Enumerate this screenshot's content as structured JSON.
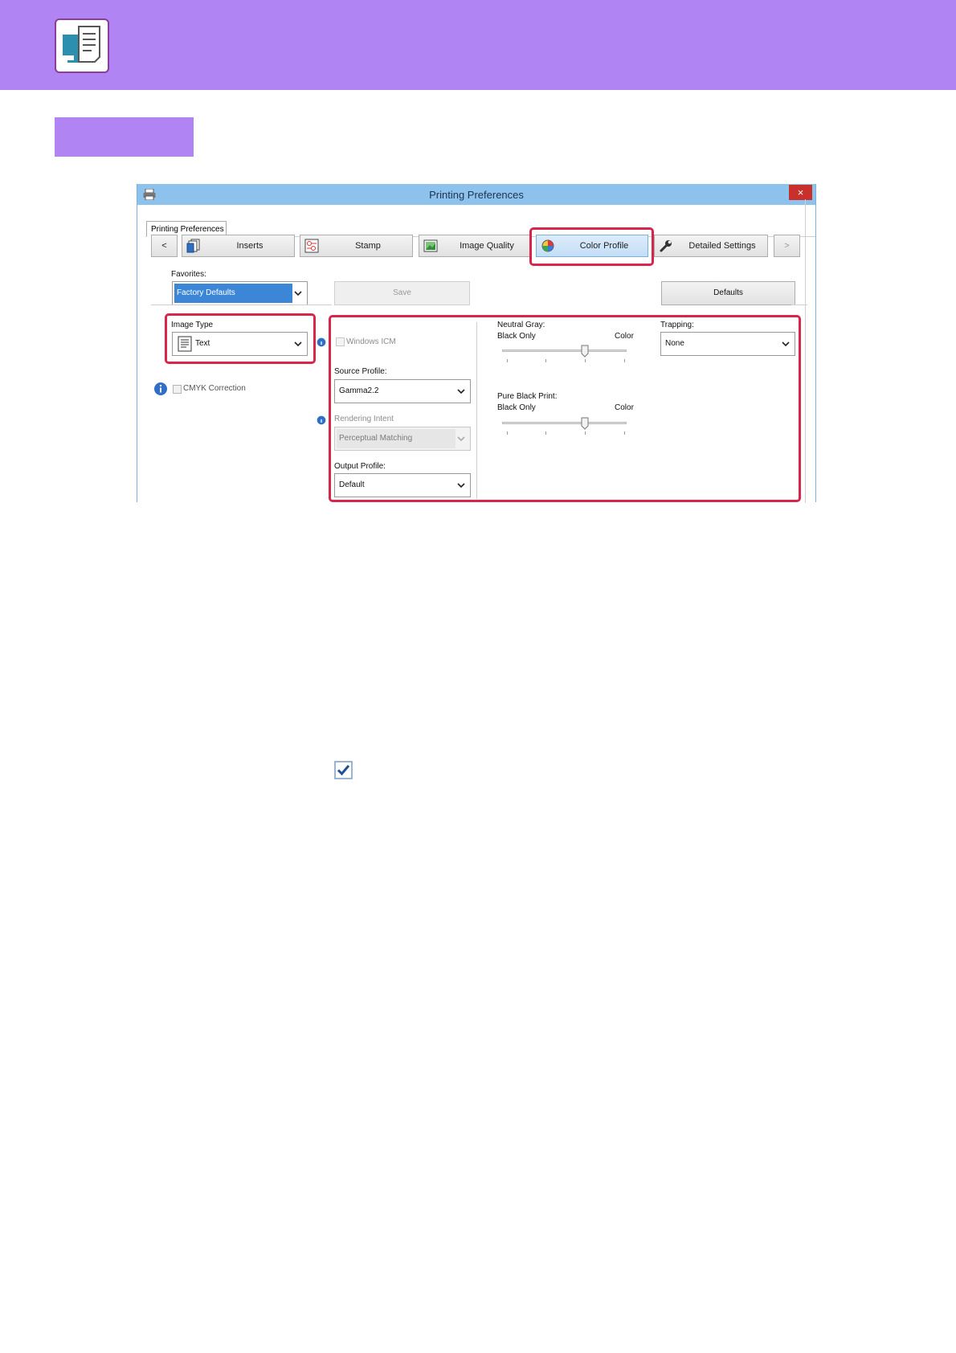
{
  "colors": {
    "banner": "#b084f2",
    "section_tab": "#b084f2",
    "highlight": "#d9254a",
    "titlebar": "#8dc2ec",
    "close": "#c9302c",
    "checkmark": "#1f4f9a"
  },
  "icons": {
    "app": "printer-monitor-icon",
    "printer": "printer-icon",
    "close": "close-icon",
    "inserts": "inserts-icon",
    "stamp": "stamp-icon",
    "image_quality": "image-quality-icon",
    "color_profile": "color-profile-icon",
    "detailed_settings": "wrench-icon",
    "info": "info-icon",
    "check": "checkmark-icon"
  },
  "dialog": {
    "title": "Printing Preferences",
    "close_label": "×",
    "tab_label": "Printing Preferences",
    "nav": {
      "prev": "<",
      "next": ">",
      "inserts": "Inserts",
      "stamp": "Stamp",
      "image_quality": "Image Quality",
      "color_profile": "Color Profile",
      "detailed_settings": "Detailed Settings"
    },
    "favorites": {
      "label": "Favorites:",
      "value": "Factory Defaults",
      "save": "Save",
      "defaults": "Defaults"
    },
    "image_type": {
      "label": "Image Type",
      "value": "Text"
    },
    "cmyk_correction": "CMYK Correction",
    "windows_icm": "Windows ICM",
    "source_profile": {
      "label": "Source Profile:",
      "value": "Gamma2.2"
    },
    "rendering_intent": {
      "label": "Rendering Intent",
      "value": "Perceptual Matching"
    },
    "output_profile": {
      "label": "Output Profile:",
      "value": "Default"
    },
    "neutral_gray": {
      "label": "Neutral Gray:",
      "left": "Black Only",
      "right": "Color"
    },
    "pure_black": {
      "label": "Pure Black Print:",
      "left": "Black Only",
      "right": "Color"
    },
    "trapping": {
      "label": "Trapping:",
      "value": "None"
    }
  }
}
